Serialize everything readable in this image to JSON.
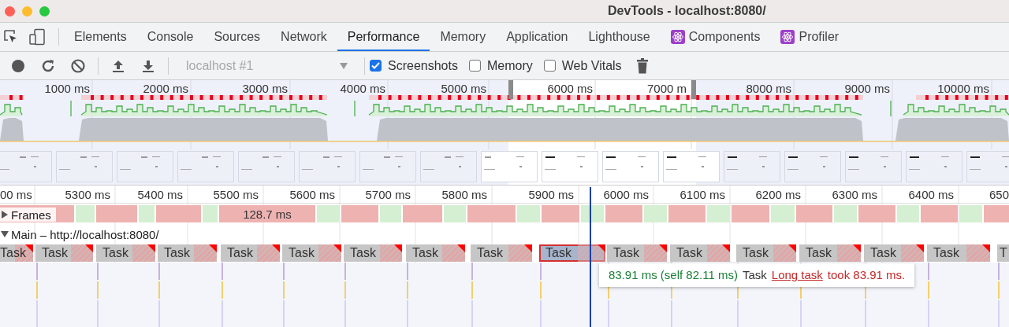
{
  "window": {
    "title": "DevTools - localhost:8080/"
  },
  "tabs": [
    {
      "label": "Elements",
      "kind": "panel",
      "selected": false
    },
    {
      "label": "Console",
      "kind": "panel",
      "selected": false
    },
    {
      "label": "Sources",
      "kind": "panel",
      "selected": false
    },
    {
      "label": "Network",
      "kind": "panel",
      "selected": false
    },
    {
      "label": "Performance",
      "kind": "panel",
      "selected": true
    },
    {
      "label": "Memory",
      "kind": "panel",
      "selected": false
    },
    {
      "label": "Application",
      "kind": "panel",
      "selected": false
    },
    {
      "label": "Lighthouse",
      "kind": "panel",
      "selected": false
    },
    {
      "label": "Components",
      "kind": "extension",
      "selected": false
    },
    {
      "label": "Profiler",
      "kind": "extension",
      "selected": false
    }
  ],
  "toolbar": {
    "target": {
      "value": "localhost #1",
      "disabled": true
    },
    "options": [
      {
        "label": "Screenshots",
        "checked": true
      },
      {
        "label": "Memory",
        "checked": false
      },
      {
        "label": "Web Vitals",
        "checked": false
      }
    ]
  },
  "overview": {
    "ticks": [
      "1000 ms",
      "2000 ms",
      "3000 ms",
      "4000 ms",
      "5000 ms",
      "6000 ms",
      "7000 m",
      "8000 ms",
      "9000 ms",
      "10000 ms"
    ]
  },
  "ruler": [
    "00 ms",
    "5300 ms",
    "5400 ms",
    "5500 ms",
    "5600 ms",
    "5700 ms",
    "5800 ms",
    "5900 ms",
    "6000 ms",
    "6100 ms",
    "6200 ms",
    "6300 ms",
    "6400 ms",
    "650"
  ],
  "frames": {
    "label": "Frames",
    "expanded": false,
    "items": [
      {
        "kind": "long"
      },
      {
        "kind": "good"
      },
      {
        "kind": "long"
      },
      {
        "kind": "good"
      },
      {
        "kind": "long"
      },
      {
        "kind": "good"
      },
      {
        "kind": "long",
        "label": "128.7 ms"
      },
      {
        "kind": "good"
      },
      {
        "kind": "long"
      },
      {
        "kind": "good"
      },
      {
        "kind": "long"
      },
      {
        "kind": "good"
      },
      {
        "kind": "long"
      },
      {
        "kind": "good"
      },
      {
        "kind": "long"
      },
      {
        "kind": "good"
      },
      {
        "kind": "long"
      },
      {
        "kind": "good"
      },
      {
        "kind": "long"
      },
      {
        "kind": "good"
      },
      {
        "kind": "long"
      },
      {
        "kind": "good"
      },
      {
        "kind": "long"
      },
      {
        "kind": "good"
      },
      {
        "kind": "long"
      },
      {
        "kind": "good"
      },
      {
        "kind": "long"
      },
      {
        "kind": "good"
      },
      {
        "kind": "long"
      }
    ]
  },
  "main": {
    "label": "Main – http://localhost:8080/",
    "expanded": true,
    "tasks": [
      {
        "label": "Task",
        "selected": false
      },
      {
        "label": "Task",
        "selected": false
      },
      {
        "label": "Task",
        "selected": false
      },
      {
        "label": "Task",
        "selected": false
      },
      {
        "label": "Task",
        "selected": false
      },
      {
        "label": "Task",
        "selected": false
      },
      {
        "label": "Task",
        "selected": false
      },
      {
        "label": "Task",
        "selected": false
      },
      {
        "label": "Task",
        "selected": false
      },
      {
        "label": "Task",
        "selected": true
      },
      {
        "label": "Task",
        "selected": false
      },
      {
        "label": "Task",
        "selected": false
      },
      {
        "label": "Task",
        "selected": false
      },
      {
        "label": "Task",
        "selected": false
      },
      {
        "label": "Task",
        "selected": false
      },
      {
        "label": "Task",
        "selected": false
      },
      {
        "label": "T",
        "selected": false
      }
    ]
  },
  "tooltip": {
    "duration": "83.91 ms (self 82.11 ms)",
    "name": "Task",
    "link": "Long task",
    "message": "took 83.91 ms."
  }
}
